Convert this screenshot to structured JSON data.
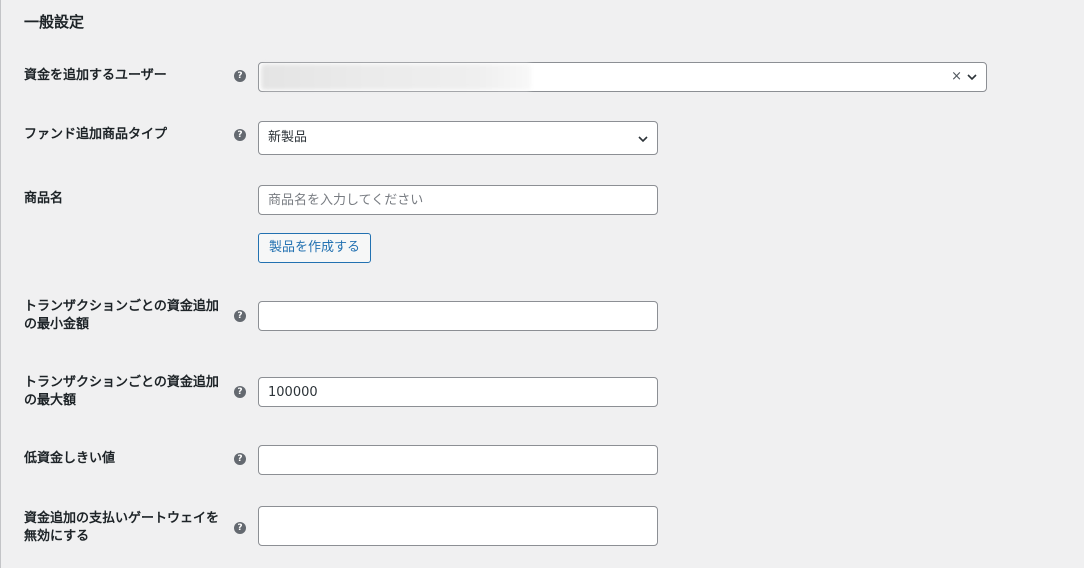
{
  "section": {
    "title": "一般設定"
  },
  "fields": {
    "user": {
      "label": "資金を追加するユーザー",
      "clear": "×"
    },
    "product_type": {
      "label": "ファンド追加商品タイプ",
      "value": "新製品"
    },
    "product_name": {
      "label": "商品名",
      "placeholder": "商品名を入力してください",
      "button": "製品を作成する"
    },
    "min_amount": {
      "label": "トランザクションごとの資金追加の最小金額",
      "value": ""
    },
    "max_amount": {
      "label": "トランザクションごとの資金追加の最大額",
      "value": "100000"
    },
    "low_threshold": {
      "label": "低資金しきい値",
      "value": ""
    },
    "disable_gateways": {
      "label": "資金追加の支払いゲートウェイを無効にする",
      "value": ""
    }
  },
  "icons": {
    "help": "help-icon",
    "help_glyph": "?",
    "dropdown": "chevron-down-icon"
  }
}
